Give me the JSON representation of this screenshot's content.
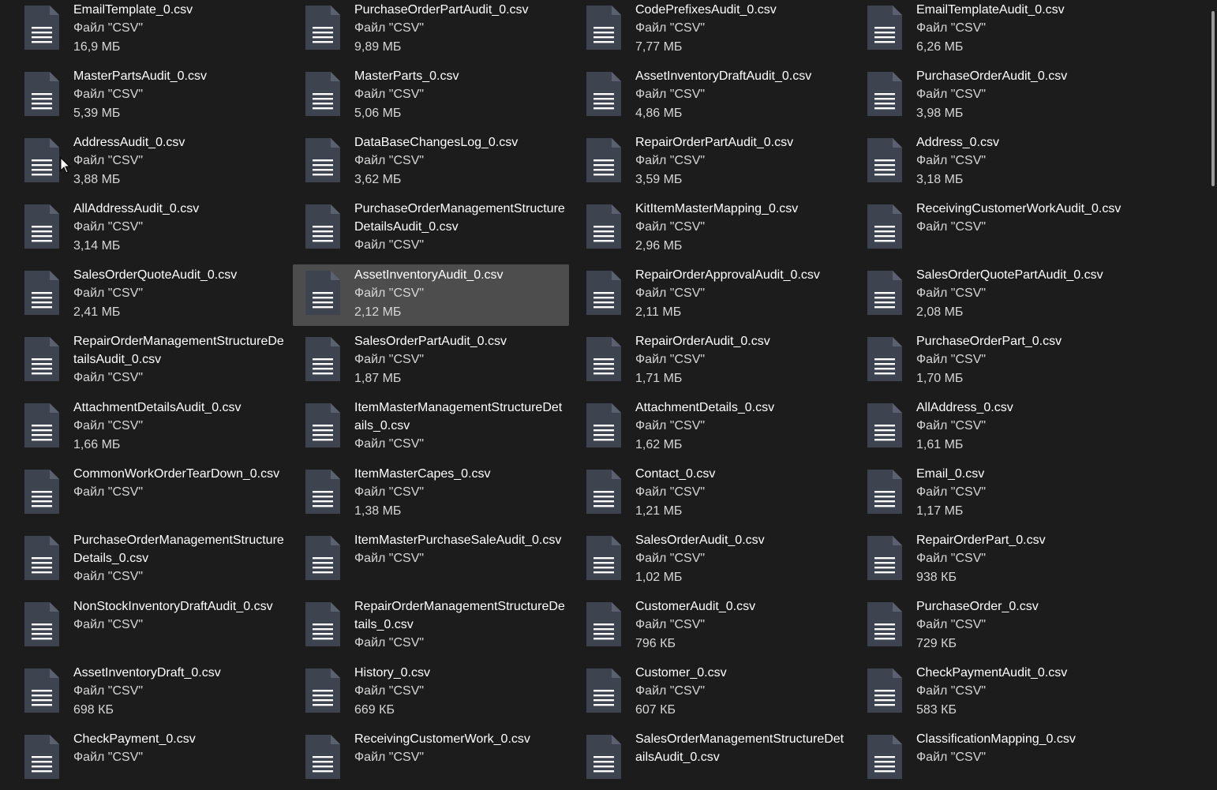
{
  "files": [
    {
      "name": "EmailTemplate_0.csv",
      "type": "Файл \"CSV\"",
      "size": "16,9 МБ"
    },
    {
      "name": "PurchaseOrderPartAudit_0.csv",
      "type": "Файл \"CSV\"",
      "size": "9,89 МБ"
    },
    {
      "name": "CodePrefixesAudit_0.csv",
      "type": "Файл \"CSV\"",
      "size": "7,77 МБ"
    },
    {
      "name": "EmailTemplateAudit_0.csv",
      "type": "Файл \"CSV\"",
      "size": "6,26 МБ"
    },
    {
      "name": "MasterPartsAudit_0.csv",
      "type": "Файл \"CSV\"",
      "size": "5,39 МБ"
    },
    {
      "name": "MasterParts_0.csv",
      "type": "Файл \"CSV\"",
      "size": "5,06 МБ"
    },
    {
      "name": "AssetInventoryDraftAudit_0.csv",
      "type": "Файл \"CSV\"",
      "size": "4,86 МБ"
    },
    {
      "name": "PurchaseOrderAudit_0.csv",
      "type": "Файл \"CSV\"",
      "size": "3,98 МБ"
    },
    {
      "name": "AddressAudit_0.csv",
      "type": "Файл \"CSV\"",
      "size": "3,88 МБ"
    },
    {
      "name": "DataBaseChangesLog_0.csv",
      "type": "Файл \"CSV\"",
      "size": "3,62 МБ"
    },
    {
      "name": "RepairOrderPartAudit_0.csv",
      "type": "Файл \"CSV\"",
      "size": "3,59 МБ"
    },
    {
      "name": "Address_0.csv",
      "type": "Файл \"CSV\"",
      "size": "3,18 МБ"
    },
    {
      "name": "AllAddressAudit_0.csv",
      "type": "Файл \"CSV\"",
      "size": "3,14 МБ"
    },
    {
      "name": "PurchaseOrderManagementStructureDetailsAudit_0.csv",
      "type": "Файл \"CSV\"",
      "size": ""
    },
    {
      "name": "KitItemMasterMapping_0.csv",
      "type": "Файл \"CSV\"",
      "size": "2,96 МБ"
    },
    {
      "name": "ReceivingCustomerWorkAudit_0.csv",
      "type": "Файл \"CSV\"",
      "size": ""
    },
    {
      "name": "SalesOrderQuoteAudit_0.csv",
      "type": "Файл \"CSV\"",
      "size": "2,41 МБ"
    },
    {
      "name": "AssetInventoryAudit_0.csv",
      "type": "Файл \"CSV\"",
      "size": "2,12 МБ",
      "selected": true
    },
    {
      "name": "RepairOrderApprovalAudit_0.csv",
      "type": "Файл \"CSV\"",
      "size": "2,11 МБ"
    },
    {
      "name": "SalesOrderQuotePartAudit_0.csv",
      "type": "Файл \"CSV\"",
      "size": "2,08 МБ"
    },
    {
      "name": "RepairOrderManagementStructureDetailsAudit_0.csv",
      "type": "Файл \"CSV\"",
      "size": ""
    },
    {
      "name": "SalesOrderPartAudit_0.csv",
      "type": "Файл \"CSV\"",
      "size": "1,87 МБ"
    },
    {
      "name": "RepairOrderAudit_0.csv",
      "type": "Файл \"CSV\"",
      "size": "1,71 МБ"
    },
    {
      "name": "PurchaseOrderPart_0.csv",
      "type": "Файл \"CSV\"",
      "size": "1,70 МБ"
    },
    {
      "name": "AttachmentDetailsAudit_0.csv",
      "type": "Файл \"CSV\"",
      "size": "1,66 МБ"
    },
    {
      "name": "ItemMasterManagementStructureDetails_0.csv",
      "type": "Файл \"CSV\"",
      "size": ""
    },
    {
      "name": "AttachmentDetails_0.csv",
      "type": "Файл \"CSV\"",
      "size": "1,62 МБ"
    },
    {
      "name": "AllAddress_0.csv",
      "type": "Файл \"CSV\"",
      "size": "1,61 МБ"
    },
    {
      "name": "CommonWorkOrderTearDown_0.csv",
      "type": "Файл \"CSV\"",
      "size": ""
    },
    {
      "name": "ItemMasterCapes_0.csv",
      "type": "Файл \"CSV\"",
      "size": "1,38 МБ"
    },
    {
      "name": "Contact_0.csv",
      "type": "Файл \"CSV\"",
      "size": "1,21 МБ"
    },
    {
      "name": "Email_0.csv",
      "type": "Файл \"CSV\"",
      "size": "1,17 МБ"
    },
    {
      "name": "PurchaseOrderManagementStructureDetails_0.csv",
      "type": "Файл \"CSV\"",
      "size": ""
    },
    {
      "name": "ItemMasterPurchaseSaleAudit_0.csv",
      "type": "Файл \"CSV\"",
      "size": ""
    },
    {
      "name": "SalesOrderAudit_0.csv",
      "type": "Файл \"CSV\"",
      "size": "1,02 МБ"
    },
    {
      "name": "RepairOrderPart_0.csv",
      "type": "Файл \"CSV\"",
      "size": "938 КБ"
    },
    {
      "name": "NonStockInventoryDraftAudit_0.csv",
      "type": "Файл \"CSV\"",
      "size": ""
    },
    {
      "name": "RepairOrderManagementStructureDetails_0.csv",
      "type": "Файл \"CSV\"",
      "size": ""
    },
    {
      "name": "CustomerAudit_0.csv",
      "type": "Файл \"CSV\"",
      "size": "796 КБ"
    },
    {
      "name": "PurchaseOrder_0.csv",
      "type": "Файл \"CSV\"",
      "size": "729 КБ"
    },
    {
      "name": "AssetInventoryDraft_0.csv",
      "type": "Файл \"CSV\"",
      "size": "698 КБ"
    },
    {
      "name": "History_0.csv",
      "type": "Файл \"CSV\"",
      "size": "669 КБ"
    },
    {
      "name": "Customer_0.csv",
      "type": "Файл \"CSV\"",
      "size": "607 КБ"
    },
    {
      "name": "CheckPaymentAudit_0.csv",
      "type": "Файл \"CSV\"",
      "size": "583 КБ"
    },
    {
      "name": "CheckPayment_0.csv",
      "type": "Файл \"CSV\"",
      "size": ""
    },
    {
      "name": "ReceivingCustomerWork_0.csv",
      "type": "Файл \"CSV\"",
      "size": ""
    },
    {
      "name": "SalesOrderManagementStructureDetailsAudit_0.csv",
      "type": "",
      "size": ""
    },
    {
      "name": "ClassificationMapping_0.csv",
      "type": "Файл \"CSV\"",
      "size": ""
    }
  ],
  "icon": "csv-file-icon"
}
